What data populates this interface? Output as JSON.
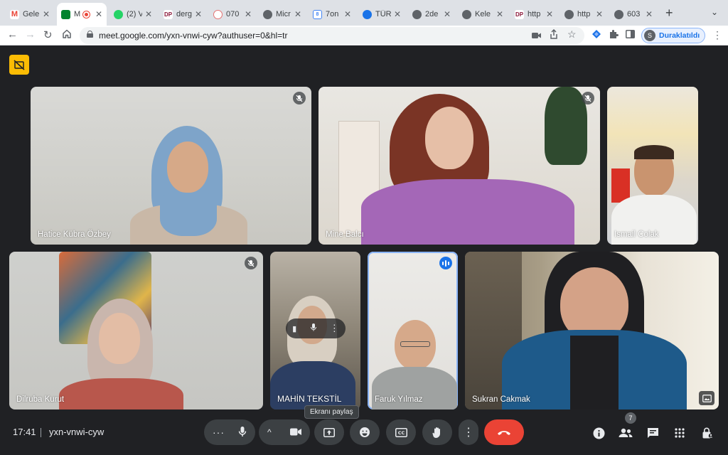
{
  "browser": {
    "tabs": [
      {
        "label": "Gele",
        "favicon": "gmail-icon",
        "color": "#ea4335"
      },
      {
        "label": "M",
        "favicon": "meet-icon",
        "color": "#00832d",
        "active": true,
        "recording": true
      },
      {
        "label": "(2) V",
        "favicon": "whatsapp-icon",
        "color": "#25d366"
      },
      {
        "label": "derg",
        "favicon": "dp-icon",
        "color": "#8a1538"
      },
      {
        "label": "070",
        "favicon": "seal-icon",
        "color": "#e57373"
      },
      {
        "label": "Micr",
        "favicon": "globe-icon",
        "color": "#5f6368"
      },
      {
        "label": "7on",
        "favicon": "doc-icon",
        "color": "#4285f4"
      },
      {
        "label": "TÜR",
        "favicon": "tr-icon",
        "color": "#1a73e8"
      },
      {
        "label": "2de",
        "favicon": "globe-icon",
        "color": "#5f6368"
      },
      {
        "label": "Kele",
        "favicon": "globe-icon",
        "color": "#5f6368"
      },
      {
        "label": "http",
        "favicon": "dp-icon",
        "color": "#8a1538"
      },
      {
        "label": "http",
        "favicon": "globe-icon",
        "color": "#5f6368"
      },
      {
        "label": "603",
        "favicon": "globe-icon",
        "color": "#5f6368"
      }
    ],
    "url": "meet.google.com/yxn-vnwi-cyw?authuser=0&hl=tr",
    "profile_label": "Duraklatıldı",
    "profile_initial": "S"
  },
  "participants": [
    {
      "name": "Hatice Kübra Özbey",
      "muted": true
    },
    {
      "name": "Mine Balcı",
      "muted": true
    },
    {
      "name": "Ismail Colak",
      "muted": false
    },
    {
      "name": "Dilruba Kurut",
      "muted": true
    },
    {
      "name": "MAHİN TEKSTİL",
      "muted": false
    },
    {
      "name": "Faruk Yılmaz",
      "speaking": true
    },
    {
      "name": "Sukran Cakmak",
      "muted": false
    }
  ],
  "tooltip": "Ekranı paylaş",
  "footer": {
    "time": "17:41",
    "meeting_code": "yxn-vnwi-cyw",
    "people_count": "7"
  },
  "colors": {
    "background": "#202124",
    "end_call": "#ea4335",
    "control": "#3c4043",
    "accent": "#8ab4f8"
  }
}
